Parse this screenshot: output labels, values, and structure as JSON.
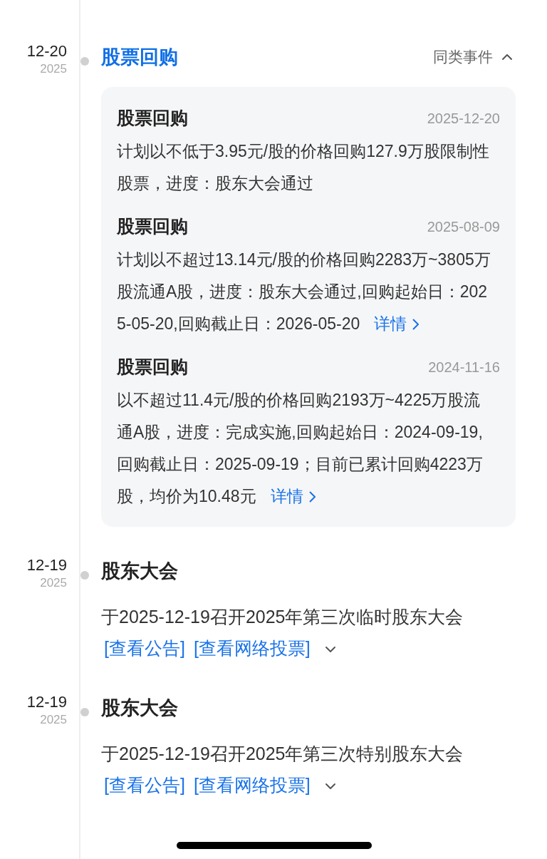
{
  "events": [
    {
      "kind": "group",
      "date": "12-20",
      "year": "2025",
      "title": "股票回购",
      "similar": {
        "label": "同类事件",
        "expanded": true
      },
      "items": [
        {
          "title": "股票回购",
          "date": "2025-12-20",
          "text": "计划以不低于3.95元/股的价格回购127.9万股限制性股票，进度：股东大会通过"
        },
        {
          "title": "股票回购",
          "date": "2025-08-09",
          "text": "计划以不超过13.14元/股的价格回购2283万~3805万股流通A股，进度：股东大会通过,回购起始日：2025-05-20,回购截止日：2026-05-20",
          "link": "详情"
        },
        {
          "title": "股票回购",
          "date": "2024-11-16",
          "text": "以不超过11.4元/股的价格回购2193万~4225万股流通A股，进度：完成实施,回购起始日：2024-09-19,回购截止日：2025-09-19；目前已累计回购4223万股，均价为10.48元",
          "link": "详情"
        }
      ]
    },
    {
      "kind": "single",
      "date": "12-19",
      "year": "2025",
      "title": "股东大会",
      "text": "于2025-12-19召开2025年第三次临时股东大会",
      "links": [
        "[查看公告]",
        "[查看网络投票]"
      ],
      "expanded": false
    },
    {
      "kind": "single",
      "date": "12-19",
      "year": "2025",
      "title": "股东大会",
      "text": "于2025-12-19召开2025年第三次特别股东大会",
      "links": [
        "[查看公告]",
        "[查看网络投票]"
      ],
      "expanded": false
    }
  ]
}
